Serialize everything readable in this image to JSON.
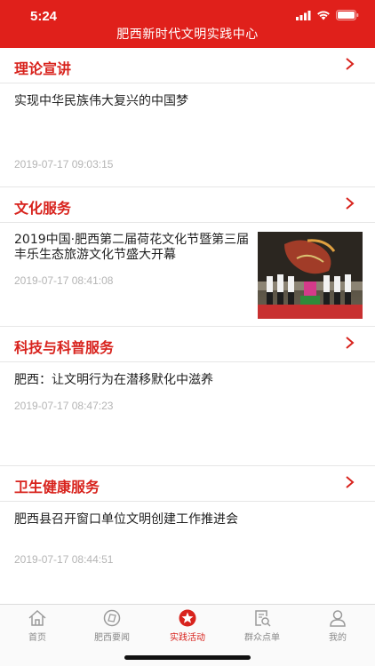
{
  "status_bar": {
    "time": "5:24"
  },
  "header": {
    "title": "肥西新时代文明实践中心"
  },
  "sections": [
    {
      "title": "理论宣讲",
      "article": {
        "title": "实现中华民族伟大复兴的中国梦",
        "date": "2019-07-17 09:03:15"
      }
    },
    {
      "title": "文化服务",
      "article": {
        "title": "2019中国·肥西第二届荷花文化节暨第三届丰乐生态旅游文化节盛大开幕",
        "date": "2019-07-17 08:41:08"
      }
    },
    {
      "title": "科技与科普服务",
      "article": {
        "title": "肥西：让文明行为在潜移默化中滋养",
        "date": "2019-07-17 08:47:23"
      }
    },
    {
      "title": "卫生健康服务",
      "article": {
        "title": "肥西县召开窗口单位文明创建工作推进会",
        "date": "2019-07-17 08:44:51"
      }
    }
  ],
  "tabs": [
    {
      "label": "首页",
      "icon": "home-icon"
    },
    {
      "label": "肥西要闻",
      "icon": "news-icon"
    },
    {
      "label": "实践活动",
      "icon": "star-icon",
      "active": true
    },
    {
      "label": "群众点单",
      "icon": "search-list-icon"
    },
    {
      "label": "我的",
      "icon": "user-icon"
    }
  ],
  "colors": {
    "brand_red": "#e0201b",
    "title_red": "#d8231d",
    "date_gray": "#b5b5b5"
  }
}
